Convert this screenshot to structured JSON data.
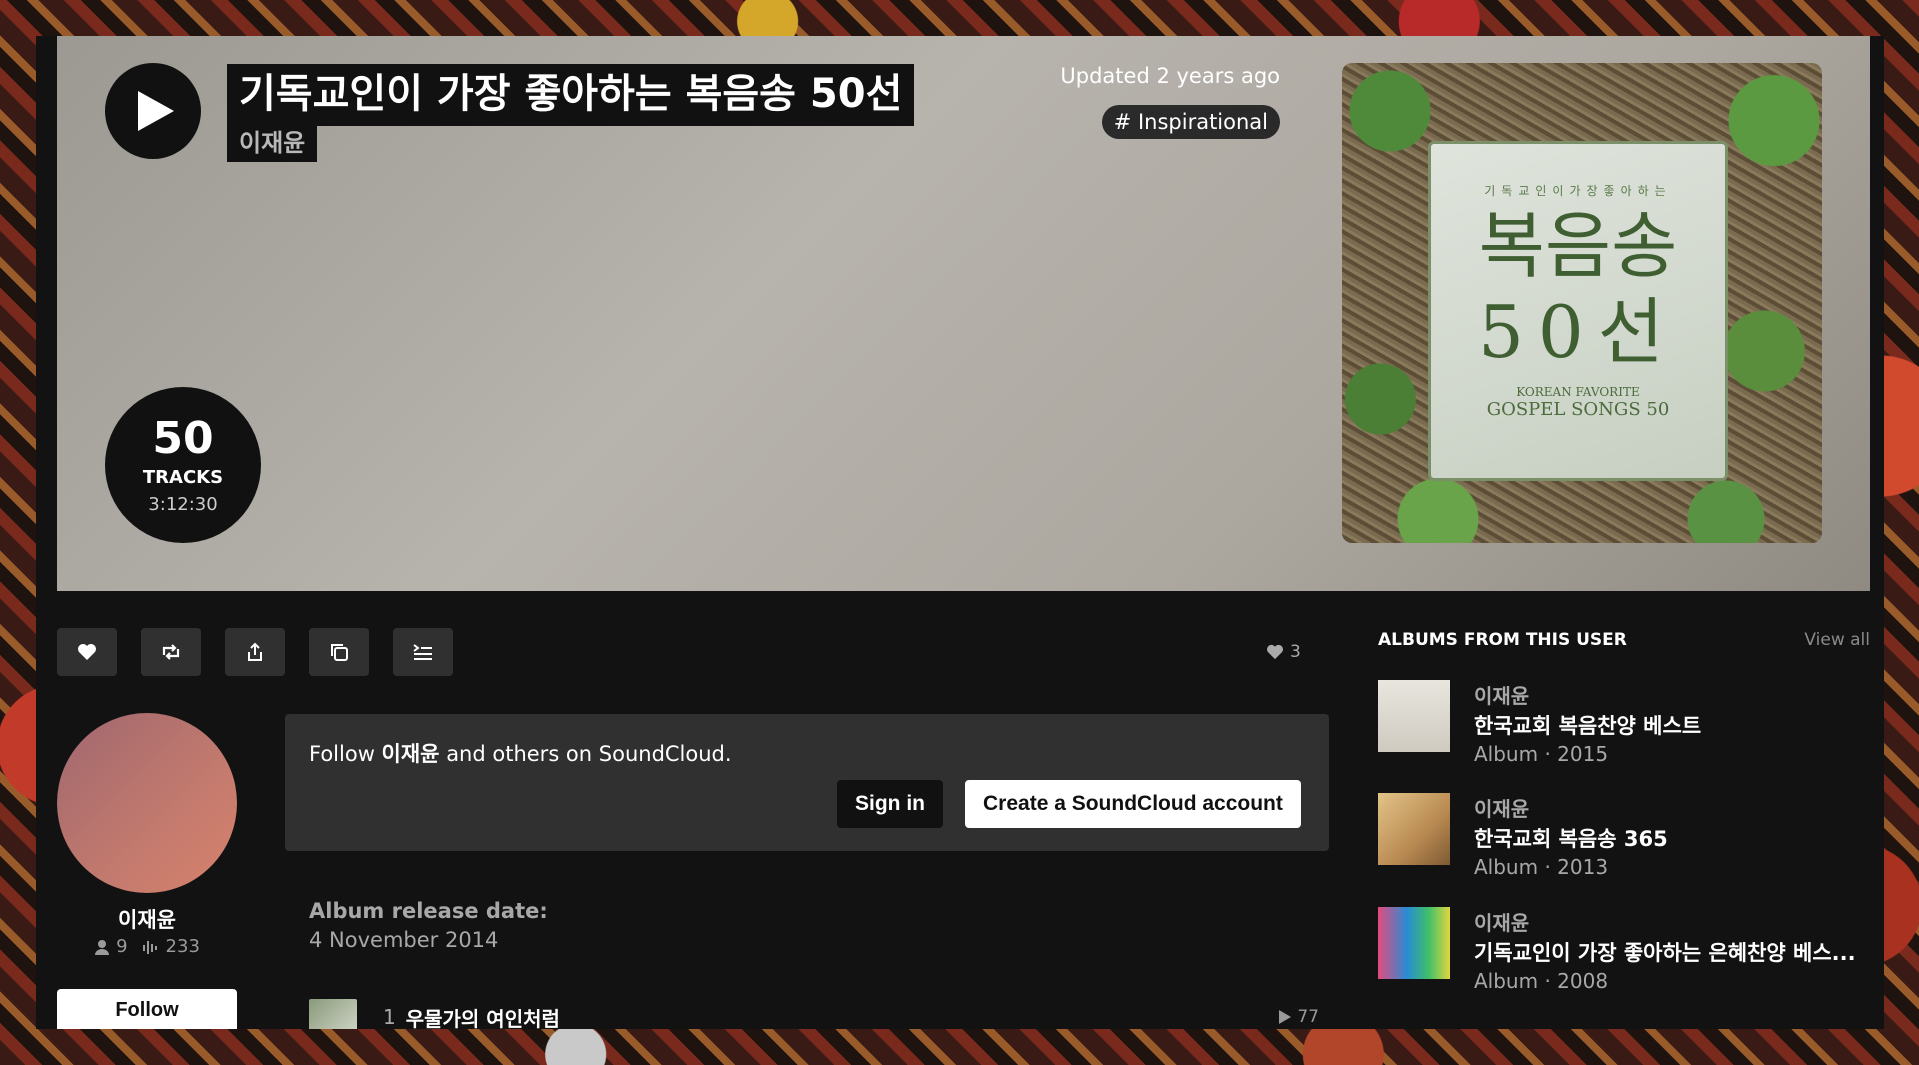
{
  "hero": {
    "title": "기독교인이 가장 좋아하는 복음송 50선",
    "artist": "이재윤",
    "updated": "Updated 2 years ago",
    "tag": "# Inspirational",
    "tracks_count": "50",
    "tracks_label": "TRACKS",
    "duration": "3:12:30",
    "cover": {
      "small_text": "기독교인이가장좋아하는",
      "big_text": "복음송",
      "num_text": "50선",
      "en_line1": "KOREAN FAVORITE",
      "en_line2": "GOSPEL SONGS 50"
    }
  },
  "actions": {
    "like_icon": "heart-icon",
    "repost_icon": "repost-icon",
    "share_icon": "share-icon",
    "copy_icon": "copy-icon",
    "queue_icon": "add-to-queue-icon",
    "likes_count": "3"
  },
  "user": {
    "name": "이재윤",
    "followers": "9",
    "tracks": "233",
    "follow_label": "Follow"
  },
  "follow_box": {
    "text_prefix": "Follow ",
    "text_name": "이재윤",
    "text_suffix": " and others on SoundCloud.",
    "signin_label": "Sign in",
    "create_label": "Create a SoundCloud account"
  },
  "release": {
    "label": "Album release date:",
    "date": "4 November 2014"
  },
  "tracks": [
    {
      "num": "1",
      "title": "우물가의 여인처럼",
      "plays": "77"
    }
  ],
  "sidebar": {
    "heading": "ALBUMS FROM THIS USER",
    "view_all": "View all",
    "albums": [
      {
        "user": "이재윤",
        "title": "한국교회 복음찬양 베스트",
        "meta": "Album · 2015"
      },
      {
        "user": "이재윤",
        "title": "한국교회 복음송 365",
        "meta": "Album · 2013"
      },
      {
        "user": "이재윤",
        "title": "기독교인이 가장 좋아하는 은혜찬양 베스...",
        "meta": "Album · 2008"
      }
    ]
  },
  "colors": {
    "background": "#121212",
    "button_bg": "#303030",
    "accent_white": "#ffffff"
  }
}
